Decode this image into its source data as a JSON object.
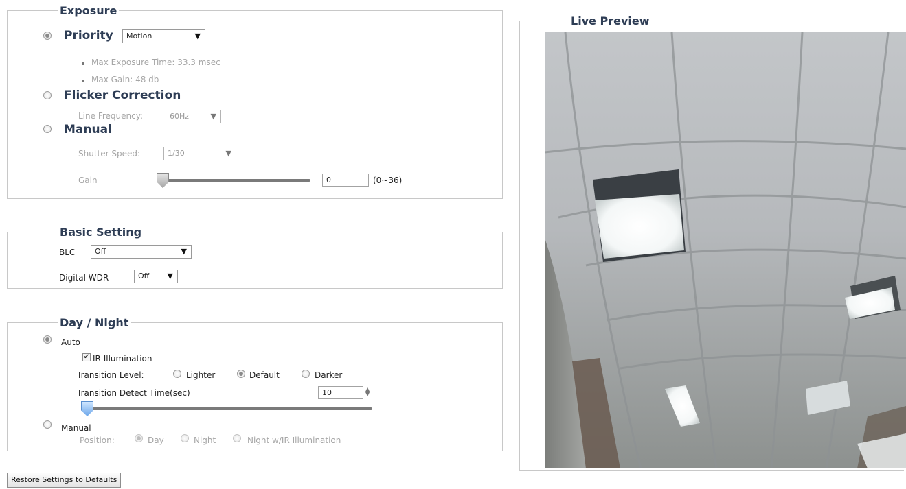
{
  "exposure": {
    "legend": "Exposure",
    "priority": {
      "label": "Priority",
      "select_value": "Motion",
      "selected": true,
      "info": [
        "Max Exposure Time: 33.3 msec",
        "Max Gain: 48 db"
      ]
    },
    "flicker": {
      "label": "Flicker Correction",
      "line_freq_label": "Line Frequency:",
      "line_freq_value": "60Hz"
    },
    "manual": {
      "label": "Manual",
      "shutter_label": "Shutter Speed:",
      "shutter_value": "1/30",
      "gain_label": "Gain",
      "gain_value": "0",
      "gain_range": "(0~36)",
      "gain_level": 0
    }
  },
  "basic": {
    "legend": "Basic Setting",
    "blc_label": "BLC",
    "blc_value": "Off",
    "wdr_label": "Digital WDR",
    "wdr_value": "Off"
  },
  "daynight": {
    "legend": "Day / Night",
    "auto_label": "Auto",
    "ir_label": "IR Illumination",
    "ir_checked": true,
    "transition_level_label": "Transition Level:",
    "levels": [
      "Lighter",
      "Default",
      "Darker"
    ],
    "selected_level": "Default",
    "detect_label": "Transition Detect Time(sec)",
    "detect_value": "10",
    "detect_level": 0,
    "manual_label": "Manual",
    "position_label": "Position:",
    "positions": [
      "Day",
      "Night",
      "Night w/IR Illumination"
    ],
    "selected_position": "Day"
  },
  "restore_button": "Restore Settings to Defaults",
  "preview": {
    "legend": "Live Preview"
  },
  "icons": {
    "dropdown_arrow": "▼",
    "check": "✔",
    "spinner": "spinner-arrows-icon"
  }
}
